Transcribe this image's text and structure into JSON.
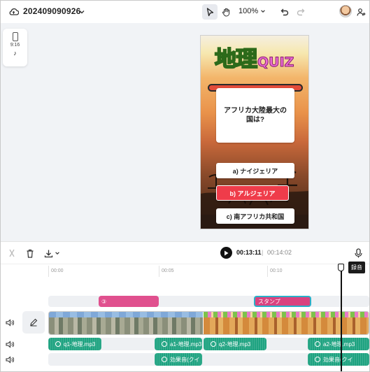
{
  "header": {
    "project_title": "202409090926",
    "zoom_label": "100%"
  },
  "canvas": {
    "aspect_ratio": "9:16",
    "platform_icon": "tiktok-icon"
  },
  "quiz": {
    "title_kanji": "地理",
    "title_en": "QUIZ",
    "question": "アフリカ大陸最大の\n国は?",
    "answers": [
      {
        "label": "a) ナイジェリア",
        "highlighted": false
      },
      {
        "label": "b) アルジェリア",
        "highlighted": true
      },
      {
        "label": "c) 南アフリカ共和国",
        "highlighted": false
      }
    ]
  },
  "timeline": {
    "current_time": "00:13:11",
    "separator": "|",
    "total_time": "00:14:02",
    "ruler": [
      "00:00",
      "00:05",
      "00:10"
    ],
    "record_tooltip": "録音",
    "sticker_tracks": [
      {
        "label": "③"
      },
      {
        "label": "スタンプ"
      }
    ],
    "audio_track_1": [
      {
        "label": "q1-地理.mp3"
      },
      {
        "label": "a1-地理.mp3"
      },
      {
        "label": "q2-地理.mp3"
      },
      {
        "label": "a2-地理.mp3"
      }
    ],
    "audio_track_2": [
      {
        "label": "効果音(クイ"
      },
      {
        "label": "効果音(クイ"
      }
    ]
  },
  "colors": {
    "accent_pink": "#e0508e",
    "audio_green": "#1fa381",
    "highlight_red": "#ef3c4a"
  }
}
